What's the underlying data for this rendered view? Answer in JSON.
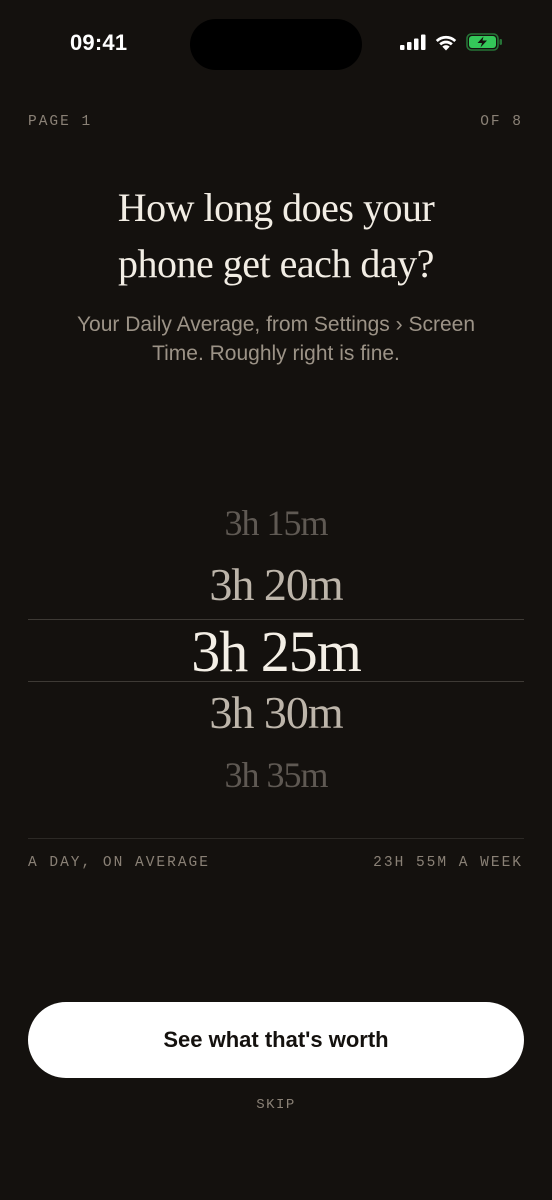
{
  "status_bar": {
    "time": "09:41",
    "icons": [
      "signal-icon",
      "wifi-icon",
      "battery-charging-icon"
    ],
    "battery_color": "#34c759"
  },
  "pager": {
    "page_label": "PAGE 1",
    "of_label": "OF 8"
  },
  "question": {
    "title_line1": "How long does your",
    "title_line2": "phone get each day?",
    "subtitle_line1": "Your Daily Average, from Settings › Screen",
    "subtitle_line2": "Time. Roughly right is fine."
  },
  "picker": {
    "options": [
      "3h 15m",
      "3h 20m",
      "3h 25m",
      "3h 30m",
      "3h 35m"
    ],
    "selected": "3h 25m"
  },
  "summary": {
    "left_label": "A DAY, ON AVERAGE",
    "right_label": "23H 55M A WEEK"
  },
  "cta": {
    "label": "See what that's worth"
  },
  "skip": {
    "label": "SKIP"
  }
}
